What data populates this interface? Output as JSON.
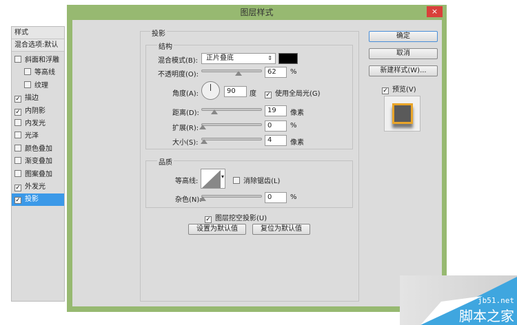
{
  "window": {
    "title": "图层样式",
    "close": "×"
  },
  "sidebar": {
    "header": "样式",
    "blend": "混合选项:默认",
    "items": [
      {
        "label": "斜面和浮雕",
        "checked": false,
        "indent": false
      },
      {
        "label": "等高线",
        "checked": false,
        "indent": true
      },
      {
        "label": "纹理",
        "checked": false,
        "indent": true
      },
      {
        "label": "描边",
        "checked": true,
        "indent": false
      },
      {
        "label": "内阴影",
        "checked": true,
        "indent": false
      },
      {
        "label": "内发光",
        "checked": false,
        "indent": false
      },
      {
        "label": "光泽",
        "checked": false,
        "indent": false
      },
      {
        "label": "颜色叠加",
        "checked": false,
        "indent": false
      },
      {
        "label": "渐变叠加",
        "checked": false,
        "indent": false
      },
      {
        "label": "图案叠加",
        "checked": false,
        "indent": false
      },
      {
        "label": "外发光",
        "checked": true,
        "indent": false
      },
      {
        "label": "投影",
        "checked": true,
        "indent": false,
        "selected": true
      }
    ]
  },
  "main": {
    "section": "投影",
    "structure": {
      "title": "结构",
      "blend_label": "混合模式(B):",
      "blend_value": "正片叠底",
      "color": "#000000",
      "opacity_label": "不透明度(O):",
      "opacity": "62",
      "opacity_unit": "%",
      "angle_label": "角度(A):",
      "angle": "90",
      "angle_unit": "度",
      "global_light": "使用全局光(G)",
      "distance_label": "距离(D):",
      "distance": "19",
      "distance_unit": "像素",
      "spread_label": "扩展(R):",
      "spread": "0",
      "spread_unit": "%",
      "size_label": "大小(S):",
      "size": "4",
      "size_unit": "像素"
    },
    "quality": {
      "title": "品质",
      "contour_label": "等高线:",
      "antialias": "消除锯齿(L)",
      "noise_label": "杂色(N):",
      "noise": "0",
      "noise_unit": "%"
    },
    "knockout": "图层挖空投影(U)",
    "set_default": "设置为默认值",
    "reset_default": "复位为默认值"
  },
  "right": {
    "ok": "确定",
    "cancel": "取消",
    "new_style": "新建样式(W)...",
    "preview": "预览(V)"
  },
  "watermark": {
    "site": "jb51.net",
    "name": "脚本之家"
  }
}
